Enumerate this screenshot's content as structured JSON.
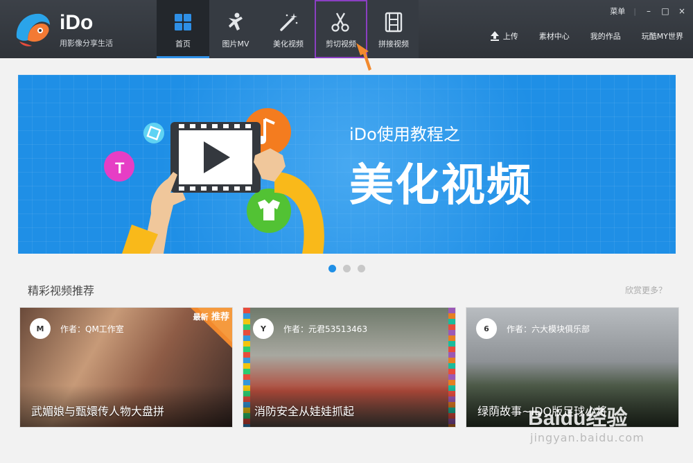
{
  "app": {
    "brand": "iDo",
    "slogan": "用影像分享生活"
  },
  "nav": [
    {
      "label": "首页",
      "icon": "home-grid-icon",
      "active": true
    },
    {
      "label": "图片MV",
      "icon": "dancer-icon",
      "active": false
    },
    {
      "label": "美化视频",
      "icon": "magic-wand-icon",
      "active": false
    },
    {
      "label": "剪切视频",
      "icon": "scissors-icon",
      "active": false,
      "highlighted": true
    },
    {
      "label": "拼接视频",
      "icon": "film-strip-icon",
      "active": false
    }
  ],
  "window_controls": {
    "menu": "菜单",
    "minimize": "–",
    "maximize": "□",
    "close": "×"
  },
  "right_links": {
    "upload": "上传",
    "material_center": "素材中心",
    "my_works": "我的作品",
    "world": "玩酷MY世界"
  },
  "banner": {
    "subtitle": "iDo使用教程之",
    "title": "美化视频",
    "slides": 3,
    "current_slide": 1
  },
  "section": {
    "title": "精彩视频推荐",
    "more": "欣赏更多？"
  },
  "videos": [
    {
      "author": "作者：QM工作室",
      "title": "武媚娘与甄嬛传人物大盘拼",
      "badge_top": "最新",
      "badge_main": "推荐"
    },
    {
      "author": "作者：元君53513463",
      "title": "消防安全从娃娃抓起"
    },
    {
      "author": "作者：六大模块俱乐部",
      "title": "绿荫故事~IDO版足球小将"
    }
  ],
  "watermark": {
    "logo": "Baidu经验",
    "url": "jingyan.baidu.com"
  },
  "colors": {
    "accent": "#1f8fe6",
    "topbar": "#33373d",
    "highlight": "#8b3fc2",
    "arrow": "#f28a2e"
  }
}
